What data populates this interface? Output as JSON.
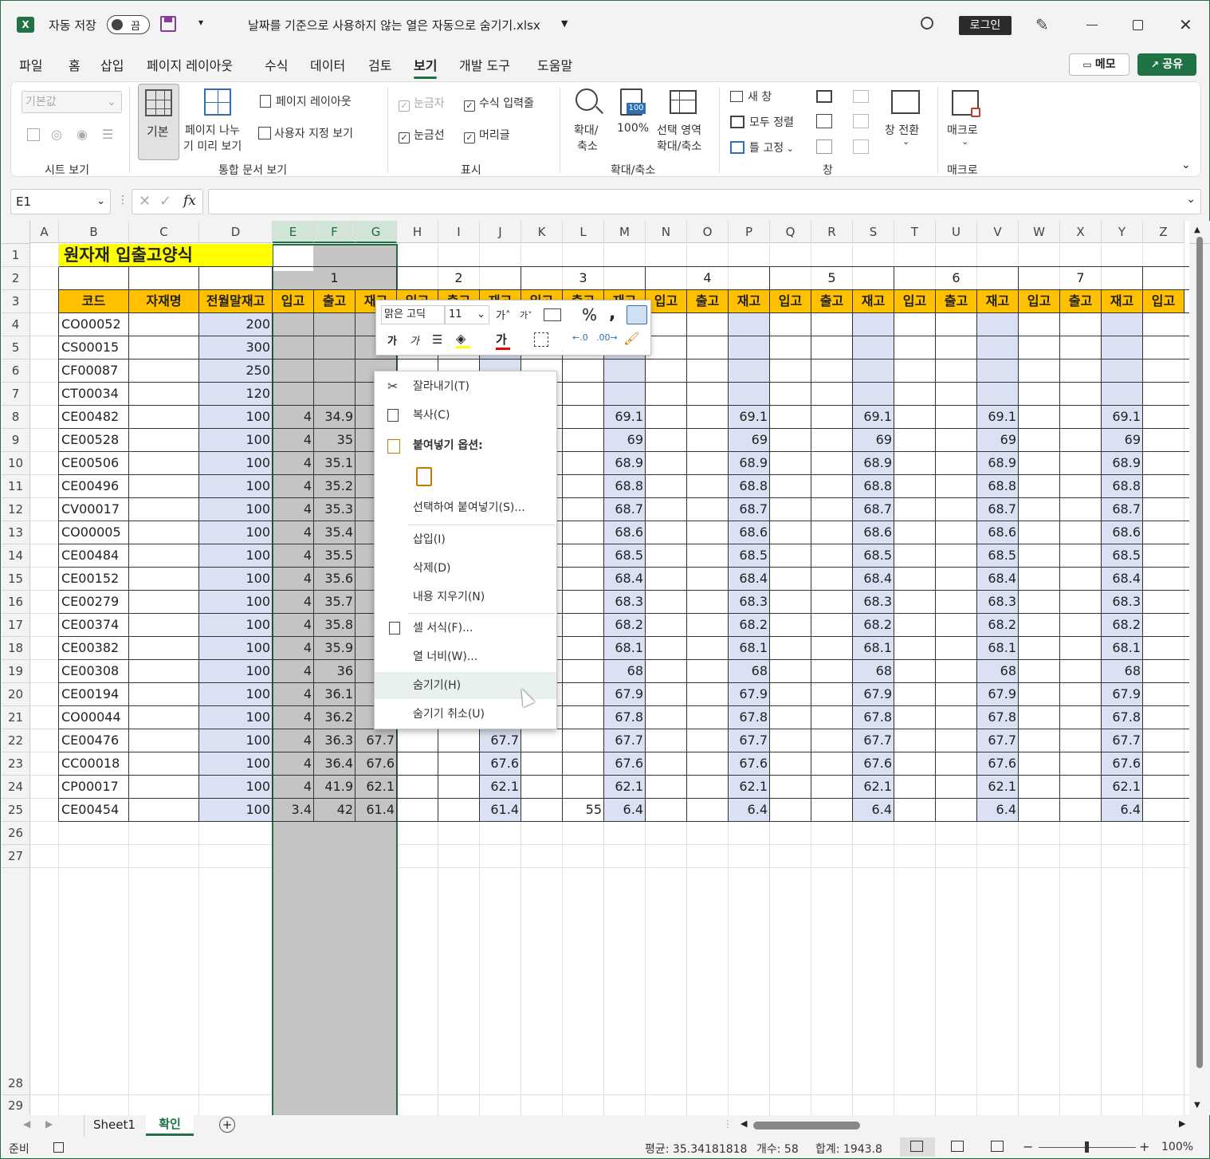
{
  "title_bar": {
    "autosave_label": "자동 저장",
    "toggle_state": "끔",
    "filename": "날짜를 기준으로 사용하지 않는 열은 자동으로 숨기기.xlsx",
    "login": "로그인"
  },
  "menu": {
    "tabs": [
      "파일",
      "홈",
      "삽입",
      "페이지 레이아웃",
      "수식",
      "데이터",
      "검토",
      "보기",
      "개발 도구",
      "도움말"
    ],
    "active_tab": "보기",
    "memo": "메모",
    "share": "공유"
  },
  "ribbon": {
    "sheet_view": {
      "dropdown": "기본값",
      "group": "시트 보기"
    },
    "workbook_views": {
      "normal": "기본",
      "page_break_1": "페이지 나누",
      "page_break_2": "기 미리 보기",
      "page_layout": "페이지 레이아웃",
      "custom": "사용자 지정 보기",
      "group": "통합 문서 보기"
    },
    "show": {
      "ruler": "눈금자",
      "formula_bar": "수식 입력줄",
      "gridlines": "눈금선",
      "headings": "머리글",
      "group": "표시"
    },
    "zoom": {
      "zoom_1": "확대/",
      "zoom_2": "축소",
      "hundred": "100%",
      "selection_1": "선택 영역",
      "selection_2": "확대/축소",
      "hundred_icon": "100",
      "group": "확대/축소"
    },
    "window": {
      "new": "새 창",
      "arrange": "모두 정렬",
      "freeze": "틀 고정",
      "switch": "창 전환",
      "group": "창"
    },
    "macros": {
      "macro": "매크로",
      "group": "매크로"
    }
  },
  "formula_bar": {
    "name_box": "E1",
    "fx": "fx",
    "content": ""
  },
  "columns": [
    "A",
    "B",
    "C",
    "D",
    "E",
    "F",
    "G",
    "H",
    "I",
    "J",
    "K",
    "L",
    "M",
    "N",
    "O",
    "P",
    "Q",
    "R",
    "S",
    "T",
    "U",
    "V",
    "W",
    "X",
    "Y",
    "Z"
  ],
  "rows": [
    "1",
    "2",
    "3",
    "4",
    "5",
    "6",
    "7",
    "8",
    "9",
    "10",
    "11",
    "12",
    "13",
    "14",
    "15",
    "16",
    "17",
    "18",
    "19",
    "20",
    "21",
    "22",
    "23",
    "24",
    "25",
    "26",
    "27",
    "28",
    "29"
  ],
  "sheet": {
    "title": "원자재 입출고양식",
    "day_numbers": [
      "1",
      "2",
      "3",
      "4",
      "5",
      "6",
      "7"
    ],
    "headers": {
      "code": "코드",
      "name": "자재명",
      "prev_stock": "전월말재고"
    },
    "sub_headers": [
      "입고",
      "출고",
      "재고"
    ],
    "data_rows": [
      {
        "code": "CO00052",
        "prev": "200",
        "e": "",
        "f": "",
        "g": "",
        "j": "",
        "l": "",
        "m": "",
        "rep": ""
      },
      {
        "code": "CS00015",
        "prev": "300",
        "e": "",
        "f": "",
        "g": "",
        "j": "",
        "l": "",
        "m": "",
        "rep": ""
      },
      {
        "code": "CF00087",
        "prev": "250",
        "e": "",
        "f": "",
        "g": "",
        "j": "",
        "l": "",
        "m": "",
        "rep": ""
      },
      {
        "code": "CT00034",
        "prev": "120",
        "e": "",
        "f": "",
        "g": "",
        "j": "",
        "l": "",
        "m": "",
        "rep": ""
      },
      {
        "code": "CE00482",
        "prev": "100",
        "e": "4",
        "f": "34.9",
        "g": "6",
        "j": "",
        "l": "",
        "m": "69.1",
        "rep": "69.1"
      },
      {
        "code": "CE00528",
        "prev": "100",
        "e": "4",
        "f": "35",
        "g": "",
        "j": "",
        "l": "",
        "m": "69",
        "rep": "69"
      },
      {
        "code": "CE00506",
        "prev": "100",
        "e": "4",
        "f": "35.1",
        "g": "6",
        "j": "",
        "l": "",
        "m": "68.9",
        "rep": "68.9"
      },
      {
        "code": "CE00496",
        "prev": "100",
        "e": "4",
        "f": "35.2",
        "g": "6",
        "j": "",
        "l": "",
        "m": "68.8",
        "rep": "68.8"
      },
      {
        "code": "CV00017",
        "prev": "100",
        "e": "4",
        "f": "35.3",
        "g": "6",
        "j": "",
        "l": "",
        "m": "68.7",
        "rep": "68.7"
      },
      {
        "code": "CO00005",
        "prev": "100",
        "e": "4",
        "f": "35.4",
        "g": "6",
        "j": "",
        "l": "",
        "m": "68.6",
        "rep": "68.6"
      },
      {
        "code": "CE00484",
        "prev": "100",
        "e": "4",
        "f": "35.5",
        "g": "6",
        "j": "",
        "l": "",
        "m": "68.5",
        "rep": "68.5"
      },
      {
        "code": "CE00152",
        "prev": "100",
        "e": "4",
        "f": "35.6",
        "g": "6",
        "j": "",
        "l": "",
        "m": "68.4",
        "rep": "68.4"
      },
      {
        "code": "CE00279",
        "prev": "100",
        "e": "4",
        "f": "35.7",
        "g": "6",
        "j": "",
        "l": "",
        "m": "68.3",
        "rep": "68.3"
      },
      {
        "code": "CE00374",
        "prev": "100",
        "e": "4",
        "f": "35.8",
        "g": "6",
        "j": "",
        "l": "",
        "m": "68.2",
        "rep": "68.2"
      },
      {
        "code": "CE00382",
        "prev": "100",
        "e": "4",
        "f": "35.9",
        "g": "6",
        "j": "",
        "l": "",
        "m": "68.1",
        "rep": "68.1"
      },
      {
        "code": "CE00308",
        "prev": "100",
        "e": "4",
        "f": "36",
        "g": "",
        "j": "",
        "l": "",
        "m": "68",
        "rep": "68"
      },
      {
        "code": "CE00194",
        "prev": "100",
        "e": "4",
        "f": "36.1",
        "g": "6",
        "j": "",
        "l": "",
        "m": "67.9",
        "rep": "67.9"
      },
      {
        "code": "CO00044",
        "prev": "100",
        "e": "4",
        "f": "36.2",
        "g": "6",
        "j": "",
        "l": "",
        "m": "67.8",
        "rep": "67.8"
      },
      {
        "code": "CE00476",
        "prev": "100",
        "e": "4",
        "f": "36.3",
        "g": "67.7",
        "j": "67.7",
        "l": "",
        "m": "67.7",
        "rep": "67.7"
      },
      {
        "code": "CC00018",
        "prev": "100",
        "e": "4",
        "f": "36.4",
        "g": "67.6",
        "j": "67.6",
        "l": "",
        "m": "67.6",
        "rep": "67.6"
      },
      {
        "code": "CP00017",
        "prev": "100",
        "e": "4",
        "f": "41.9",
        "g": "62.1",
        "j": "62.1",
        "l": "",
        "m": "62.1",
        "rep": "62.1"
      },
      {
        "code": "CE00454",
        "prev": "100",
        "e": "3.4",
        "f": "42",
        "g": "61.4",
        "j": "61.4",
        "l": "55",
        "m": "6.4",
        "rep": "6.4"
      }
    ]
  },
  "mini_toolbar": {
    "font": "맑은 고딕",
    "size": "11",
    "bold": "가",
    "italic": "가",
    "font_color": "가",
    "inc_font": "가",
    "dec_font": "가"
  },
  "context_menu": {
    "cut": "잘라내기(T)",
    "copy": "복사(C)",
    "paste_options": "붙여넣기 옵션:",
    "paste_special": "선택하여 붙여넣기(S)...",
    "insert": "삽입(I)",
    "delete": "삭제(D)",
    "clear": "내용 지우기(N)",
    "format_cells": "셀 서식(F)...",
    "column_width": "열 너비(W)...",
    "hide": "숨기기(H)",
    "unhide": "숨기기 취소(U)"
  },
  "sheet_tabs": {
    "tabs": [
      "Sheet1",
      "확인"
    ],
    "active": "확인"
  },
  "status_bar": {
    "ready": "준비",
    "average": "평균: 35.34181818",
    "count": "개수: 58",
    "sum": "합계: 1943.8",
    "zoom": "100%"
  },
  "colors": {
    "accent": "#1f7244",
    "header_fill": "#ffc000",
    "title_fill": "#ffff00",
    "stock_fill": "#d9e1f2",
    "selection": "#c4c4c4"
  }
}
